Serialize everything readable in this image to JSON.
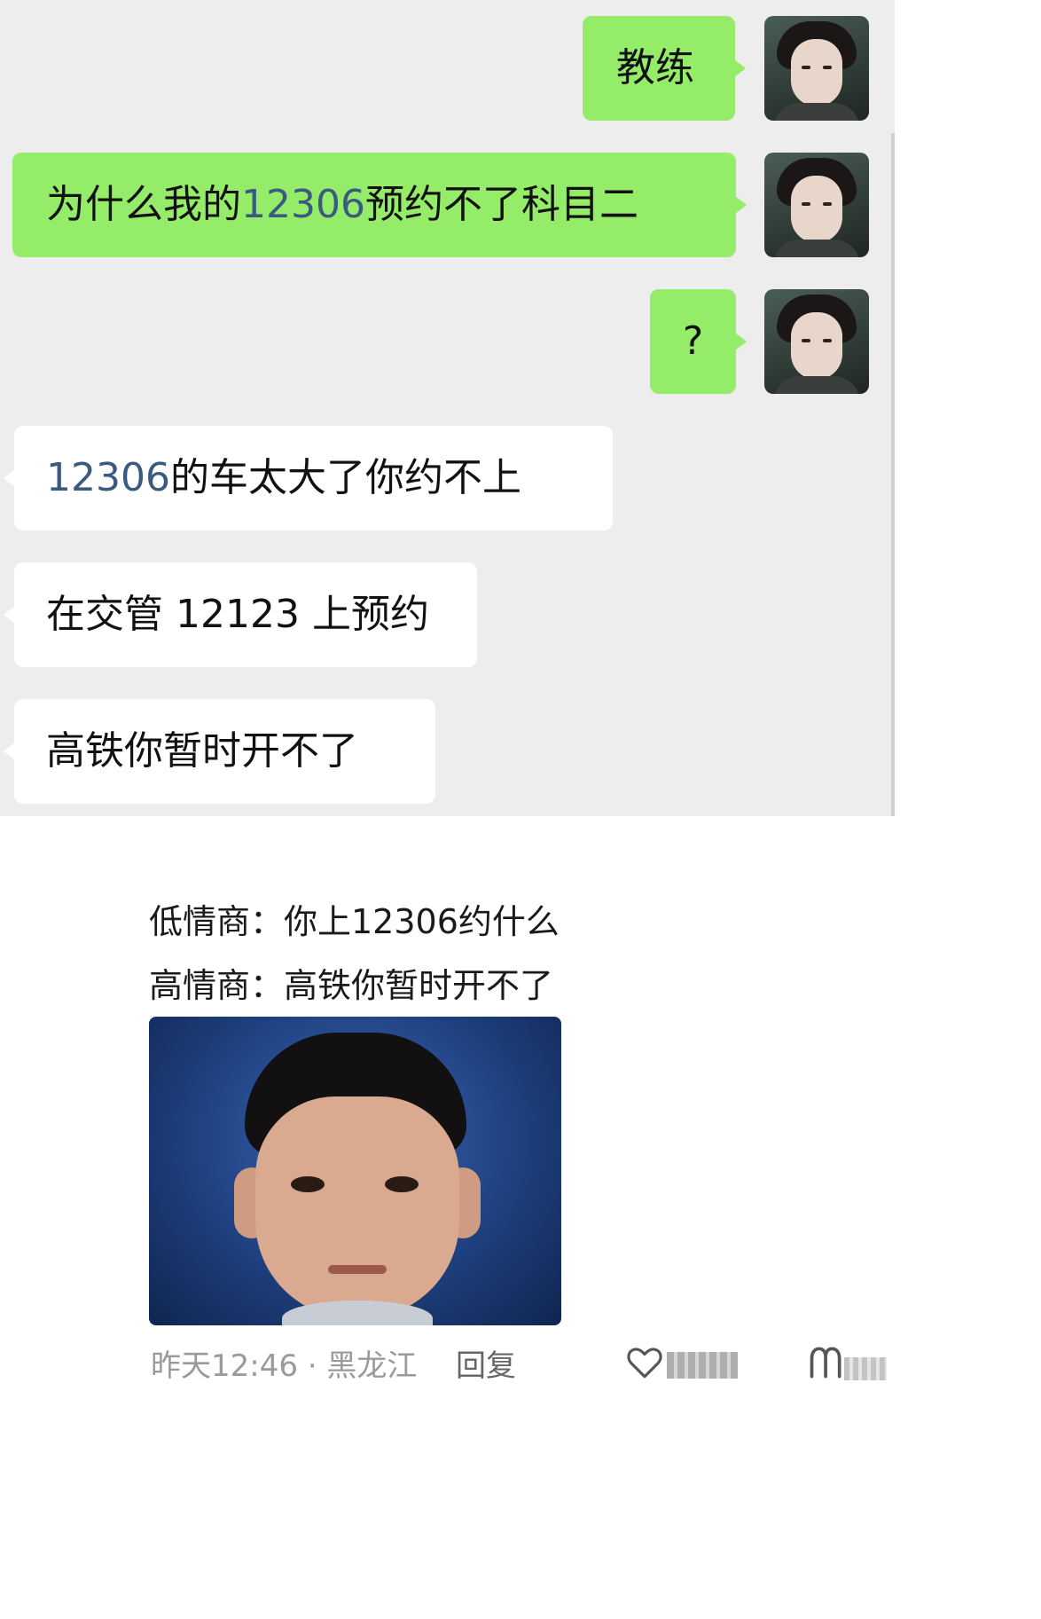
{
  "chat": {
    "messages": [
      {
        "side": "out",
        "text": "教练"
      },
      {
        "side": "out",
        "num": "12306",
        "before": "为什么我的",
        "after": "预约不了科目二"
      },
      {
        "side": "out",
        "text": "?"
      },
      {
        "side": "in",
        "num": "12306",
        "before": "",
        "after": "的车太大了你约不上"
      },
      {
        "side": "in",
        "text": "在交管 12123 上预约"
      },
      {
        "side": "in",
        "text": "高铁你暂时开不了"
      }
    ],
    "colors": {
      "outgoing": "#95ec69",
      "incoming": "#ffffff",
      "background": "#ededed",
      "number": "#3a5a80"
    }
  },
  "post": {
    "line1": "低情商：你上12306约什么",
    "line2": "高情商：高铁你暂时开不了",
    "meta": "昨天12:46 · 黑龙江",
    "reply_label": "回复"
  }
}
